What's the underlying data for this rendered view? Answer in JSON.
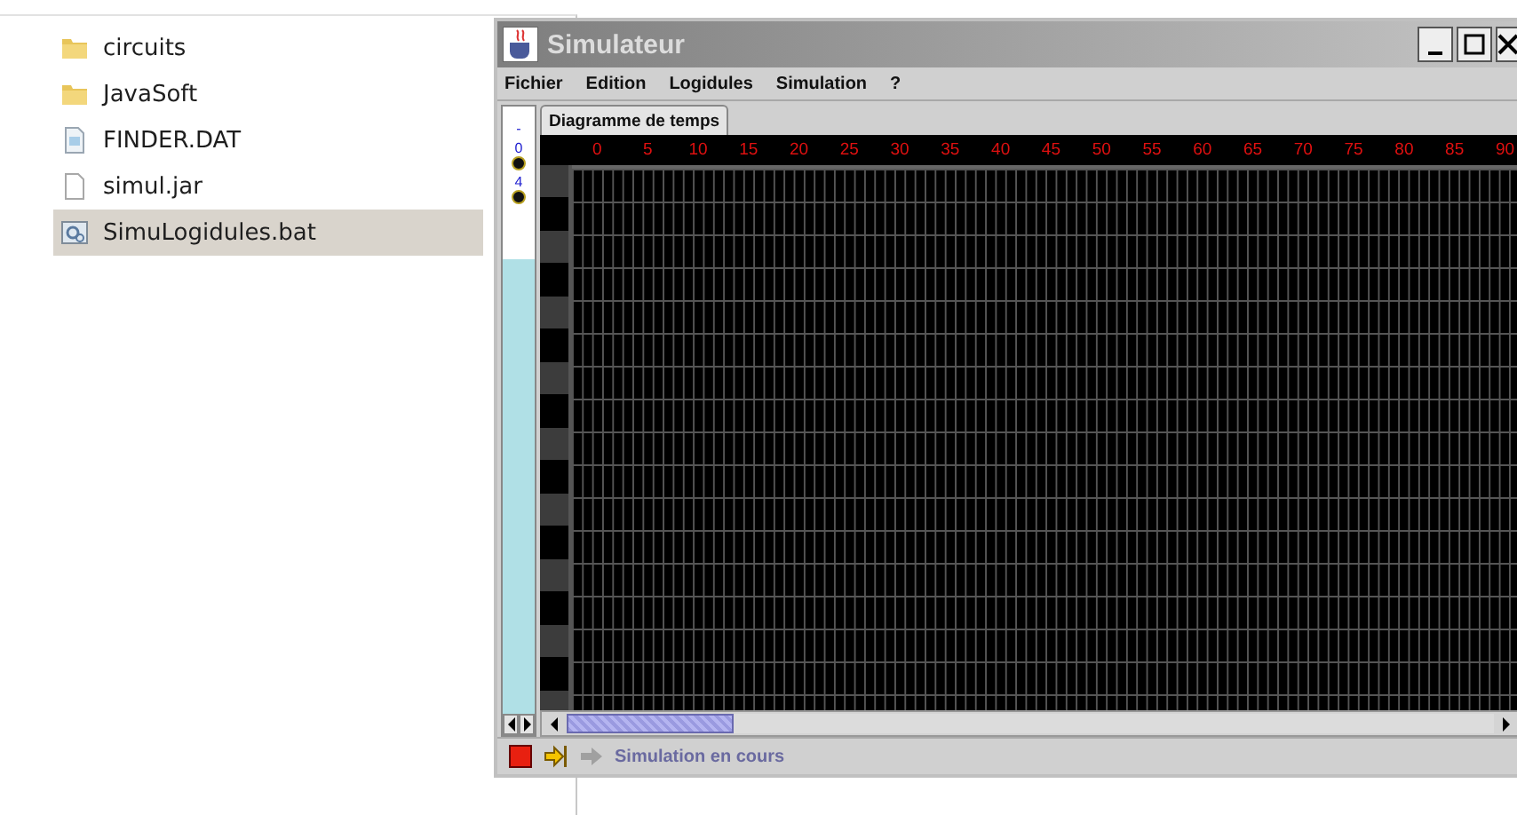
{
  "files": [
    {
      "name": "circuits",
      "kind": "folder",
      "selected": false
    },
    {
      "name": "JavaSoft",
      "kind": "folder",
      "selected": false
    },
    {
      "name": "FINDER.DAT",
      "kind": "data",
      "selected": false
    },
    {
      "name": "simul.jar",
      "kind": "file",
      "selected": false
    },
    {
      "name": "SimuLogidules.bat",
      "kind": "batch",
      "selected": true
    }
  ],
  "window": {
    "title": "Simulateur"
  },
  "menu": [
    "Fichier",
    "Edition",
    "Logidules",
    "Simulation",
    "?"
  ],
  "tabs": [
    {
      "label": "Diagramme de temps",
      "selected": true
    }
  ],
  "side_markers": [
    {
      "label": "-",
      "dot": false
    },
    {
      "label": "0",
      "dot": true
    },
    {
      "label": "4",
      "dot": true
    }
  ],
  "time_ticks": [
    "0",
    "5",
    "10",
    "15",
    "20",
    "25",
    "30",
    "35",
    "40",
    "45",
    "50",
    "55",
    "60",
    "65",
    "70",
    "75",
    "80",
    "85",
    "90"
  ],
  "scrollbar": {
    "level": 0.18
  },
  "status": {
    "text": "Simulation en cours"
  }
}
